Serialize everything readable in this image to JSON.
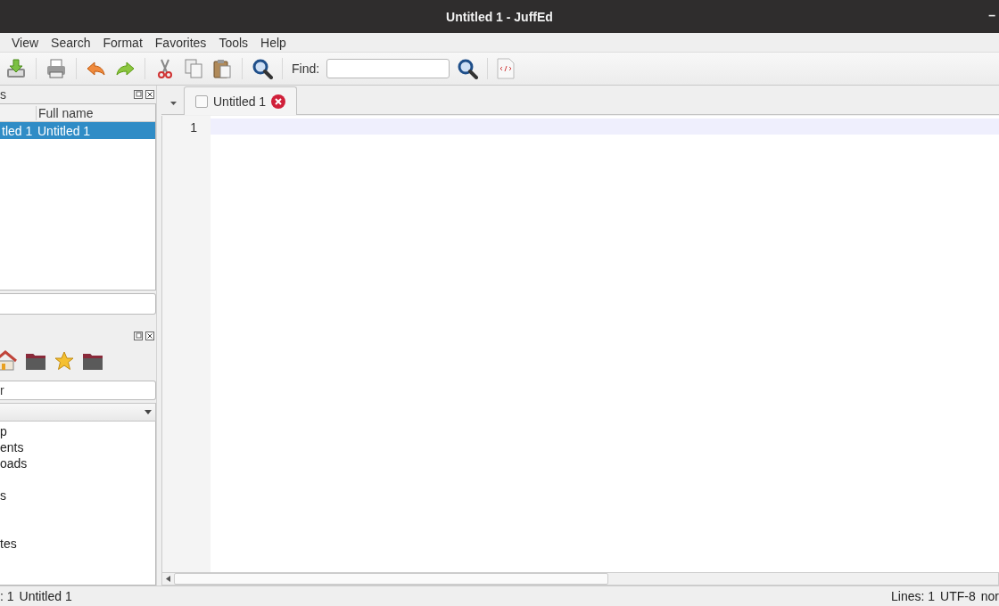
{
  "window": {
    "title": "Untitled 1 - JuffEd",
    "controls": [
      "–"
    ]
  },
  "menu": [
    "View",
    "Search",
    "Format",
    "Favorites",
    "Tools",
    "Help"
  ],
  "toolbar": {
    "find_label": "Find:"
  },
  "documents_panel": {
    "title": "s",
    "columns": [
      {
        "kind": "blank"
      },
      {
        "kind": "label",
        "label": "Full name"
      }
    ],
    "rows": [
      {
        "cells": [
          "tled 1",
          "Untitled 1"
        ],
        "selected": true
      }
    ]
  },
  "file_panel": {
    "path": "r",
    "items": [
      {
        "kind": "entry",
        "label": "p"
      },
      {
        "kind": "entry",
        "label": "ents"
      },
      {
        "kind": "entry",
        "label": "oads"
      },
      {
        "kind": "blank"
      },
      {
        "kind": "entry",
        "label": "s"
      },
      {
        "kind": "blank"
      },
      {
        "kind": "blank"
      },
      {
        "kind": "entry",
        "label": "tes"
      }
    ]
  },
  "editor": {
    "tabs": [
      {
        "label": "Untitled 1",
        "selected": true
      }
    ],
    "line_numbers": [
      "1"
    ]
  },
  "status_bar": {
    "left": [
      ": 1",
      "Untitled 1"
    ],
    "right": [
      "Lines: 1",
      "UTF-8",
      "nor"
    ]
  }
}
